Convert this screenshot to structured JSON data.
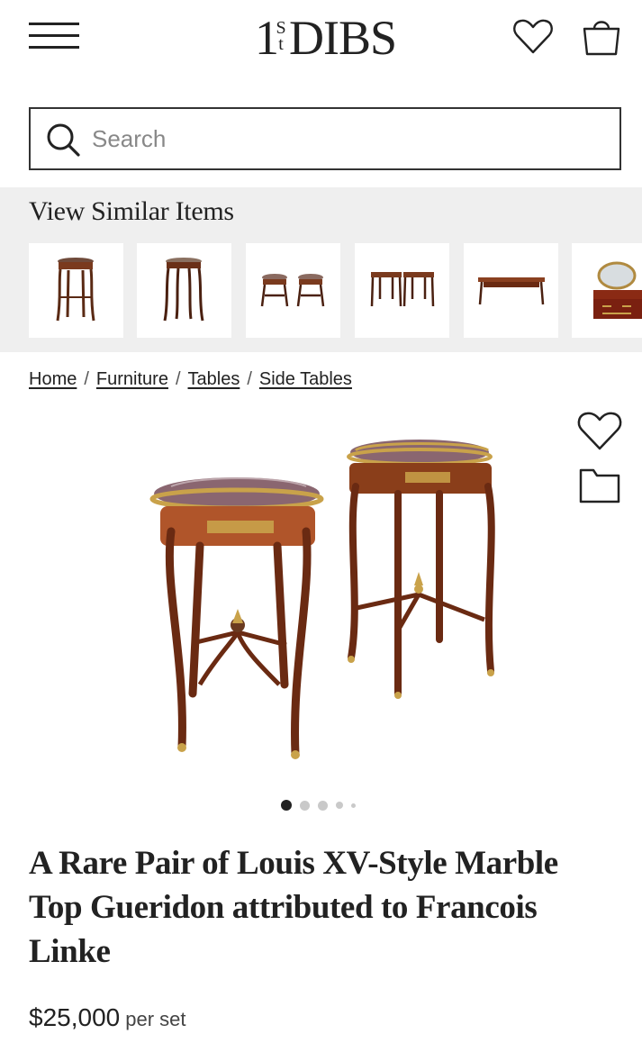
{
  "header": {
    "logo_number": "1",
    "logo_s": "S",
    "logo_t": "t",
    "logo_name": "DIBS"
  },
  "search": {
    "placeholder": "Search"
  },
  "similar": {
    "title": "View Similar Items",
    "items": [
      {
        "icon": "round-side-table-thumb"
      },
      {
        "icon": "tall-gueridon-thumb"
      },
      {
        "icon": "pair-of-tables-thumb"
      },
      {
        "icon": "pair-of-consoles-thumb"
      },
      {
        "icon": "writing-desk-thumb"
      },
      {
        "icon": "vanity-dresser-thumb"
      }
    ]
  },
  "breadcrumb": {
    "items": [
      "Home",
      "Furniture",
      "Tables",
      "Side Tables"
    ],
    "separator": "/"
  },
  "product": {
    "title": "A Rare Pair of Louis XV-Style Marble Top Gueridon attributed to Francois Linke",
    "price": "$25,000",
    "price_unit": "per set",
    "carousel_total": 5,
    "carousel_active": 1
  },
  "colors": {
    "wood": "#7a3a1e",
    "gilt": "#c9a24a",
    "marble": "#8a6670",
    "page_bg": "#ffffff",
    "similar_bg": "#efefef"
  }
}
